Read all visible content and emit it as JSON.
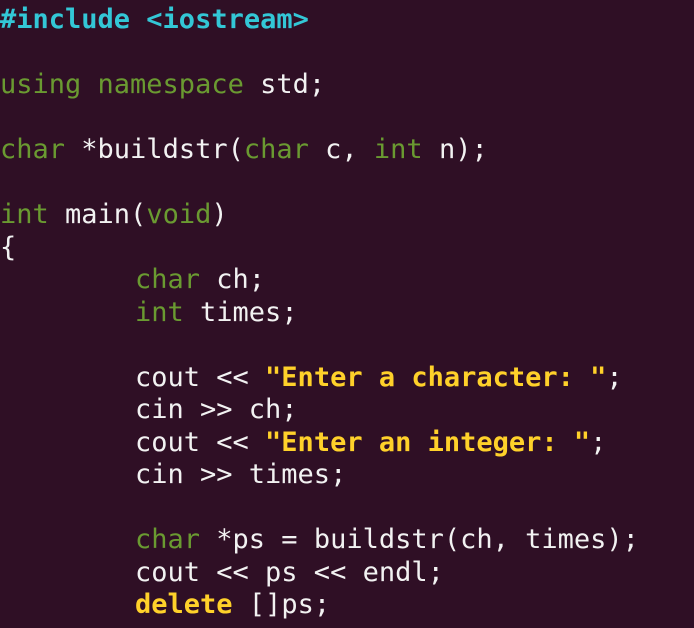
{
  "editor": {
    "lines": [
      {
        "tokens": [
          {
            "t": "#include <iostream>",
            "c": "pp"
          }
        ]
      },
      {
        "tokens": []
      },
      {
        "tokens": [
          {
            "t": "using namespace",
            "c": "kw"
          },
          {
            "t": " std;",
            "c": "pl"
          }
        ]
      },
      {
        "tokens": []
      },
      {
        "tokens": [
          {
            "t": "char",
            "c": "kw"
          },
          {
            "t": " *buildstr(",
            "c": "pl"
          },
          {
            "t": "char",
            "c": "kw"
          },
          {
            "t": " c, ",
            "c": "pl"
          },
          {
            "t": "int",
            "c": "kw"
          },
          {
            "t": " n);",
            "c": "pl"
          }
        ]
      },
      {
        "tokens": []
      },
      {
        "tokens": [
          {
            "t": "int",
            "c": "kw"
          },
          {
            "t": " main(",
            "c": "pl"
          },
          {
            "t": "void",
            "c": "kw"
          },
          {
            "t": ")",
            "c": "pl"
          }
        ]
      },
      {
        "tokens": [
          {
            "t": "{",
            "c": "pl"
          }
        ]
      },
      {
        "indent": true,
        "tokens": [
          {
            "t": "char",
            "c": "kw"
          },
          {
            "t": " ch;",
            "c": "pl"
          }
        ]
      },
      {
        "indent": true,
        "tokens": [
          {
            "t": "int",
            "c": "kw"
          },
          {
            "t": " times;",
            "c": "pl"
          }
        ]
      },
      {
        "tokens": []
      },
      {
        "indent": true,
        "tokens": [
          {
            "t": "cout << ",
            "c": "pl"
          },
          {
            "t": "\"Enter a character: \"",
            "c": "str"
          },
          {
            "t": ";",
            "c": "pl"
          }
        ]
      },
      {
        "indent": true,
        "tokens": [
          {
            "t": "cin >> ch;",
            "c": "pl"
          }
        ]
      },
      {
        "indent": true,
        "tokens": [
          {
            "t": "cout << ",
            "c": "pl"
          },
          {
            "t": "\"Enter an integer: \"",
            "c": "str"
          },
          {
            "t": ";",
            "c": "pl"
          }
        ]
      },
      {
        "indent": true,
        "tokens": [
          {
            "t": "cin >> times;",
            "c": "pl"
          }
        ]
      },
      {
        "tokens": []
      },
      {
        "indent": true,
        "tokens": [
          {
            "t": "char",
            "c": "kw"
          },
          {
            "t": " *ps = buildstr(ch, times);",
            "c": "pl"
          }
        ]
      },
      {
        "indent": true,
        "tokens": [
          {
            "t": "cout << ps << endl;",
            "c": "pl"
          }
        ]
      },
      {
        "indent": true,
        "tokens": [
          {
            "t": "delete",
            "c": "kwb"
          },
          {
            "t": " []ps;",
            "c": "pl"
          }
        ]
      }
    ]
  },
  "colors": {
    "background": "#2f0f25",
    "plain": "#f2f2f2",
    "preprocessor": "#33c7d6",
    "keyword": "#6a9a31",
    "string": "#ffd12a"
  }
}
